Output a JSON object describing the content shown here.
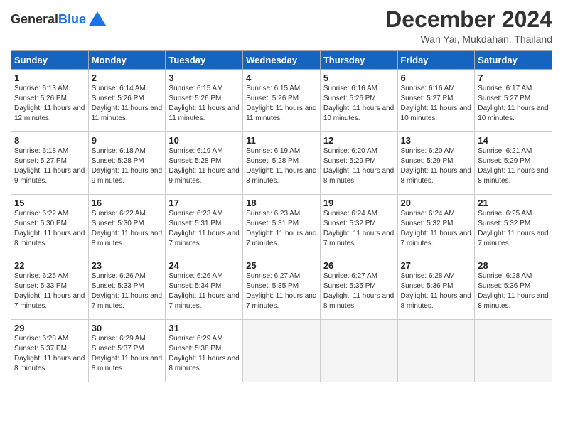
{
  "logo": {
    "line1": "General",
    "line2": "Blue"
  },
  "title": "December 2024",
  "location": "Wan Yai, Mukdahan, Thailand",
  "weekdays": [
    "Sunday",
    "Monday",
    "Tuesday",
    "Wednesday",
    "Thursday",
    "Friday",
    "Saturday"
  ],
  "weeks": [
    [
      {
        "day": "1",
        "sunrise": "Sunrise: 6:13 AM",
        "sunset": "Sunset: 5:26 PM",
        "daylight": "Daylight: 11 hours and 12 minutes."
      },
      {
        "day": "2",
        "sunrise": "Sunrise: 6:14 AM",
        "sunset": "Sunset: 5:26 PM",
        "daylight": "Daylight: 11 hours and 11 minutes."
      },
      {
        "day": "3",
        "sunrise": "Sunrise: 6:15 AM",
        "sunset": "Sunset: 5:26 PM",
        "daylight": "Daylight: 11 hours and 11 minutes."
      },
      {
        "day": "4",
        "sunrise": "Sunrise: 6:15 AM",
        "sunset": "Sunset: 5:26 PM",
        "daylight": "Daylight: 11 hours and 11 minutes."
      },
      {
        "day": "5",
        "sunrise": "Sunrise: 6:16 AM",
        "sunset": "Sunset: 5:26 PM",
        "daylight": "Daylight: 11 hours and 10 minutes."
      },
      {
        "day": "6",
        "sunrise": "Sunrise: 6:16 AM",
        "sunset": "Sunset: 5:27 PM",
        "daylight": "Daylight: 11 hours and 10 minutes."
      },
      {
        "day": "7",
        "sunrise": "Sunrise: 6:17 AM",
        "sunset": "Sunset: 5:27 PM",
        "daylight": "Daylight: 11 hours and 10 minutes."
      }
    ],
    [
      {
        "day": "8",
        "sunrise": "Sunrise: 6:18 AM",
        "sunset": "Sunset: 5:27 PM",
        "daylight": "Daylight: 11 hours and 9 minutes."
      },
      {
        "day": "9",
        "sunrise": "Sunrise: 6:18 AM",
        "sunset": "Sunset: 5:28 PM",
        "daylight": "Daylight: 11 hours and 9 minutes."
      },
      {
        "day": "10",
        "sunrise": "Sunrise: 6:19 AM",
        "sunset": "Sunset: 5:28 PM",
        "daylight": "Daylight: 11 hours and 9 minutes."
      },
      {
        "day": "11",
        "sunrise": "Sunrise: 6:19 AM",
        "sunset": "Sunset: 5:28 PM",
        "daylight": "Daylight: 11 hours and 8 minutes."
      },
      {
        "day": "12",
        "sunrise": "Sunrise: 6:20 AM",
        "sunset": "Sunset: 5:29 PM",
        "daylight": "Daylight: 11 hours and 8 minutes."
      },
      {
        "day": "13",
        "sunrise": "Sunrise: 6:20 AM",
        "sunset": "Sunset: 5:29 PM",
        "daylight": "Daylight: 11 hours and 8 minutes."
      },
      {
        "day": "14",
        "sunrise": "Sunrise: 6:21 AM",
        "sunset": "Sunset: 5:29 PM",
        "daylight": "Daylight: 11 hours and 8 minutes."
      }
    ],
    [
      {
        "day": "15",
        "sunrise": "Sunrise: 6:22 AM",
        "sunset": "Sunset: 5:30 PM",
        "daylight": "Daylight: 11 hours and 8 minutes."
      },
      {
        "day": "16",
        "sunrise": "Sunrise: 6:22 AM",
        "sunset": "Sunset: 5:30 PM",
        "daylight": "Daylight: 11 hours and 8 minutes."
      },
      {
        "day": "17",
        "sunrise": "Sunrise: 6:23 AM",
        "sunset": "Sunset: 5:31 PM",
        "daylight": "Daylight: 11 hours and 7 minutes."
      },
      {
        "day": "18",
        "sunrise": "Sunrise: 6:23 AM",
        "sunset": "Sunset: 5:31 PM",
        "daylight": "Daylight: 11 hours and 7 minutes."
      },
      {
        "day": "19",
        "sunrise": "Sunrise: 6:24 AM",
        "sunset": "Sunset: 5:32 PM",
        "daylight": "Daylight: 11 hours and 7 minutes."
      },
      {
        "day": "20",
        "sunrise": "Sunrise: 6:24 AM",
        "sunset": "Sunset: 5:32 PM",
        "daylight": "Daylight: 11 hours and 7 minutes."
      },
      {
        "day": "21",
        "sunrise": "Sunrise: 6:25 AM",
        "sunset": "Sunset: 5:32 PM",
        "daylight": "Daylight: 11 hours and 7 minutes."
      }
    ],
    [
      {
        "day": "22",
        "sunrise": "Sunrise: 6:25 AM",
        "sunset": "Sunset: 5:33 PM",
        "daylight": "Daylight: 11 hours and 7 minutes."
      },
      {
        "day": "23",
        "sunrise": "Sunrise: 6:26 AM",
        "sunset": "Sunset: 5:33 PM",
        "daylight": "Daylight: 11 hours and 7 minutes."
      },
      {
        "day": "24",
        "sunrise": "Sunrise: 6:26 AM",
        "sunset": "Sunset: 5:34 PM",
        "daylight": "Daylight: 11 hours and 7 minutes."
      },
      {
        "day": "25",
        "sunrise": "Sunrise: 6:27 AM",
        "sunset": "Sunset: 5:35 PM",
        "daylight": "Daylight: 11 hours and 7 minutes."
      },
      {
        "day": "26",
        "sunrise": "Sunrise: 6:27 AM",
        "sunset": "Sunset: 5:35 PM",
        "daylight": "Daylight: 11 hours and 8 minutes."
      },
      {
        "day": "27",
        "sunrise": "Sunrise: 6:28 AM",
        "sunset": "Sunset: 5:36 PM",
        "daylight": "Daylight: 11 hours and 8 minutes."
      },
      {
        "day": "28",
        "sunrise": "Sunrise: 6:28 AM",
        "sunset": "Sunset: 5:36 PM",
        "daylight": "Daylight: 11 hours and 8 minutes."
      }
    ],
    [
      {
        "day": "29",
        "sunrise": "Sunrise: 6:28 AM",
        "sunset": "Sunset: 5:37 PM",
        "daylight": "Daylight: 11 hours and 8 minutes."
      },
      {
        "day": "30",
        "sunrise": "Sunrise: 6:29 AM",
        "sunset": "Sunset: 5:37 PM",
        "daylight": "Daylight: 11 hours and 8 minutes."
      },
      {
        "day": "31",
        "sunrise": "Sunrise: 6:29 AM",
        "sunset": "Sunset: 5:38 PM",
        "daylight": "Daylight: 11 hours and 8 minutes."
      },
      null,
      null,
      null,
      null
    ]
  ]
}
